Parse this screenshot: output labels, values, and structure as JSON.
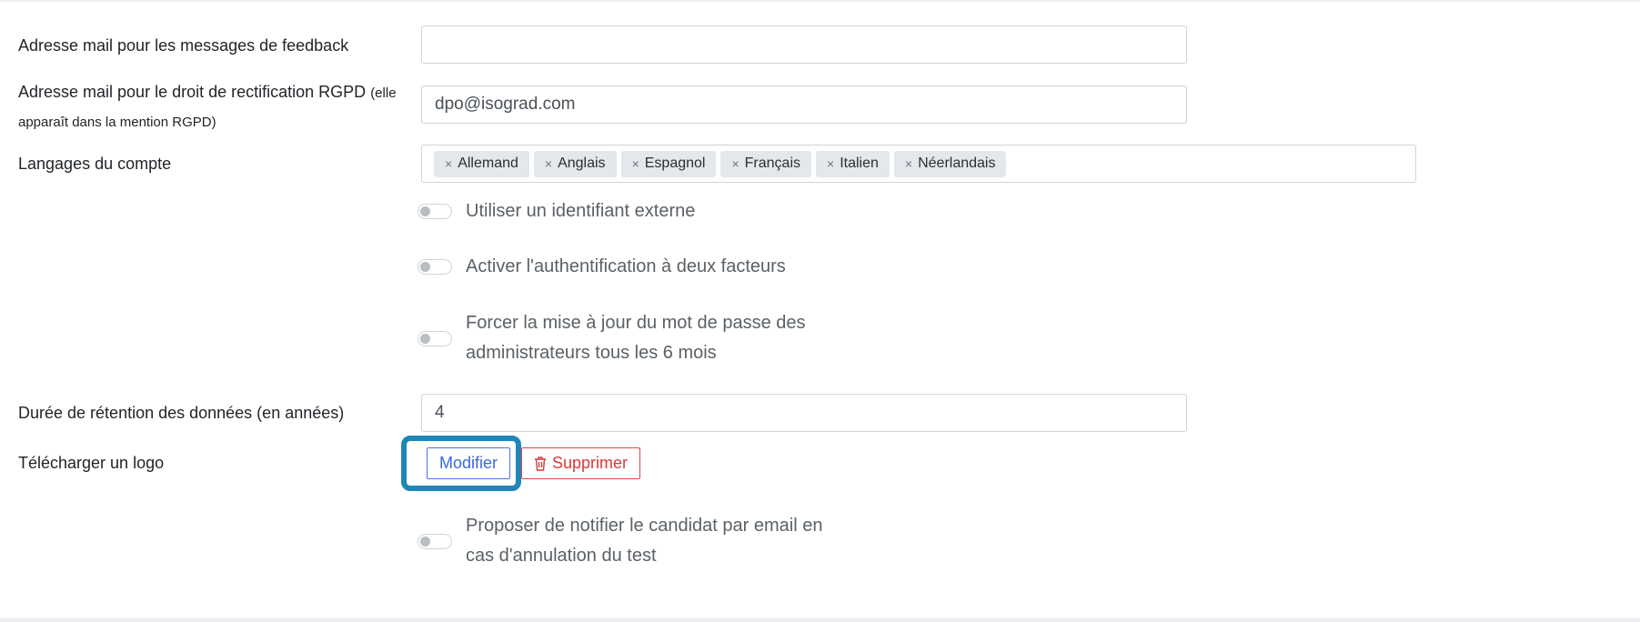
{
  "form": {
    "feedback_email": {
      "label": "Adresse mail pour les messages de feedback",
      "value": ""
    },
    "rgpd_email": {
      "label": "Adresse mail pour le droit de rectification RGPD",
      "label_small_1": "(elle",
      "label_small_2": "apparaît dans la mention RGPD)",
      "value": "dpo@isograd.com"
    },
    "languages": {
      "label": "Langages du compte",
      "remove_glyph": "×",
      "tags": [
        "Allemand",
        "Anglais",
        "Espagnol",
        "Français",
        "Italien",
        "Néerlandais"
      ]
    },
    "toggles": {
      "external_id": {
        "label": "Utiliser un identifiant externe",
        "on": false
      },
      "two_factor": {
        "label": "Activer l'authentification à deux facteurs",
        "on": false
      },
      "force_password": {
        "label_line1": "Forcer la mise à jour du mot de passe des",
        "label_line2": "administrateurs tous les 6 mois",
        "on": false
      },
      "notify_candidate": {
        "label_line1": "Proposer de notifier le candidat par email en",
        "label_line2": "cas d'annulation du test",
        "on": false
      }
    },
    "retention": {
      "label": "Durée de rétention des données (en années)",
      "value": "4"
    },
    "logo": {
      "label": "Télécharger un logo",
      "modify_label": "Modifier",
      "delete_label": "Supprimer",
      "delete_icon": "trash-icon"
    }
  },
  "colors": {
    "highlight": "#1f87b8",
    "primary": "#3a66e0",
    "danger": "#d93838"
  }
}
